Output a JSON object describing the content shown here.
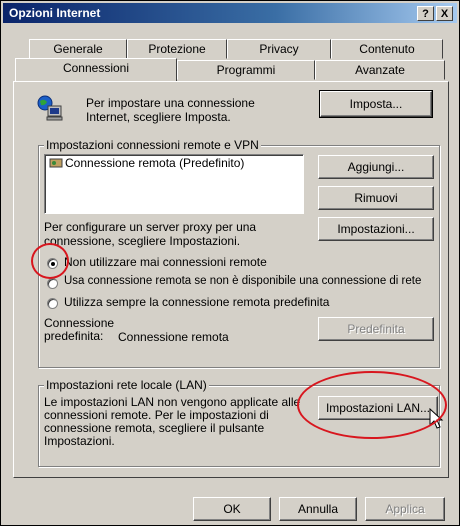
{
  "window": {
    "title": "Opzioni Internet"
  },
  "title_buttons": {
    "help": "?",
    "close": "X"
  },
  "tabs_back": [
    "Generale",
    "Protezione",
    "Privacy",
    "Contenuto"
  ],
  "tabs_front": [
    "Connessioni",
    "Programmi",
    "Avanzate"
  ],
  "setup": {
    "text_line1": "Per impostare una connessione",
    "text_line2": "Internet, scegliere Imposta.",
    "button": "Imposta..."
  },
  "dialup": {
    "legend": "Impostazioni connessioni remote e VPN",
    "list_items": [
      "Connessione remota (Predefinito)"
    ],
    "add_button": "Aggiungi...",
    "remove_button": "Rimuovi",
    "settings_button": "Impostazioni...",
    "proxy_line1": "Per configurare un server proxy per una",
    "proxy_line2": "connessione, scegliere Impostazioni.",
    "radio_never": "Non utilizzare mai connessioni remote",
    "radio_when_none": "Usa connessione remota se non è disponibile una connessione di rete",
    "radio_always": "Utilizza sempre la connessione remota predefinita",
    "default_label_line1": "Connessione",
    "default_label_line2": "predefinita:",
    "default_value": "Connessione remota",
    "set_default_button": "Predefinita"
  },
  "lan": {
    "legend": "Impostazioni rete locale (LAN)",
    "text_line1": "Le impostazioni LAN non vengono applicate alle",
    "text_line2": "connessioni remote. Per le impostazioni di",
    "text_line3": "connessione remota, scegliere il pulsante",
    "text_line4": "Impostazioni.",
    "button": "Impostazioni LAN..."
  },
  "footer": {
    "ok": "OK",
    "cancel": "Annulla",
    "apply": "Applica"
  },
  "colors": {
    "title_start": "#0a246a",
    "title_end": "#a6caf0",
    "annotation": "#d8161e",
    "face": "#d4d0c8"
  }
}
